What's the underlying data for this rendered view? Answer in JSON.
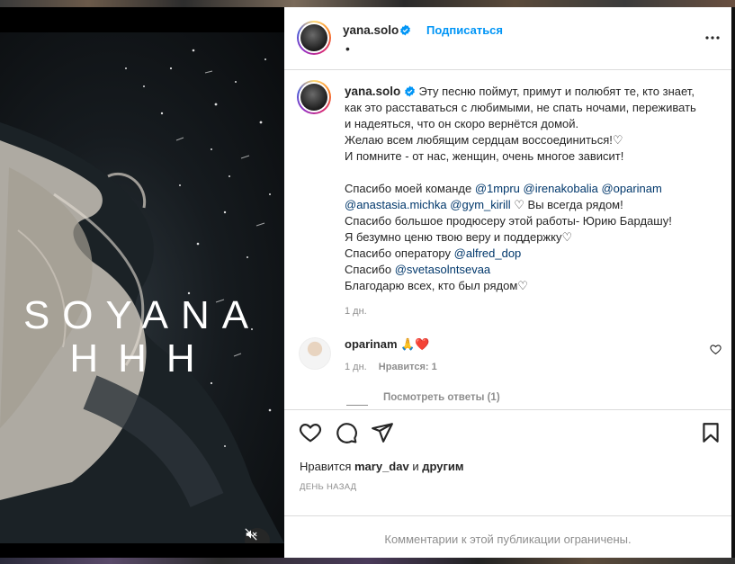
{
  "post": {
    "username": "yana.solo",
    "follow_label": "Подписаться",
    "header_dot": "•",
    "video": {
      "brand_line1": "SOYANA",
      "brand_line2": "HHH",
      "mute_icon": "muted-speaker-icon"
    },
    "caption": {
      "username": "yana.solo",
      "text_before": "Эту песню поймут, примут и полюбят те, кто знает, как это расставаться с любимыми, не спать ночами, переживать и надеяться, что он скоро вернётся домой.",
      "line2": "Желаю всем любящим сердцам воссоединиться!♡",
      "line3": "И помните - от нас, женщин, очень многое зависит!",
      "thanks_team_prefix": "Спасибо моей команде",
      "tags_team": [
        "@1mpru",
        "@irenakobalia",
        "@oparinam",
        "@anastasia.michka",
        "@gym_kirill"
      ],
      "thanks_team_suffix": "♡ Вы всегда рядом!",
      "line_producer": "Спасибо большое продюсеру этой работы- Юрию Бардашу!",
      "line_faith": "Я безумно ценю твою веру и поддержку♡",
      "operator_prefix": "Спасибо оператору",
      "operator_tag": "@alfred_dop",
      "thanks_prefix": "Спасибо",
      "thanks_tag": "@svetasolntsevaa",
      "line_all": "Благодарю всех, кто был рядом♡",
      "time": "1 дн."
    },
    "comment": {
      "username": "oparinam",
      "text": "🙏❤️",
      "time": "1 дн.",
      "likes": "Нравится: 1",
      "view_replies": "Посмотреть ответы (1)"
    },
    "likes": {
      "prefix": "Нравится",
      "user": "mary_dav",
      "connector": "и",
      "others": "другим"
    },
    "posted_ago": "ДЕНЬ НАЗАД",
    "restricted_text": "Комментарии к этой публикации ограничены."
  },
  "colors": {
    "accent": "#0095f6",
    "tag": "#00376b",
    "muted": "#8e8e8e",
    "heart": "#ed4956"
  }
}
